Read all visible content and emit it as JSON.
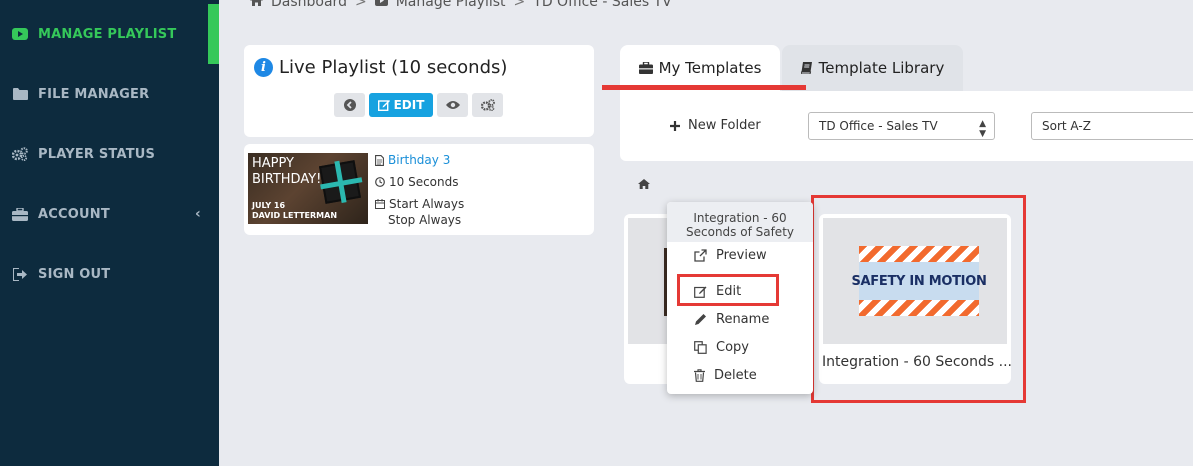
{
  "sidebar": {
    "items": [
      {
        "label": "MANAGE PLAYLIST",
        "icon": "play-icon",
        "active": true
      },
      {
        "label": "FILE MANAGER",
        "icon": "folder-icon",
        "active": false
      },
      {
        "label": "PLAYER STATUS",
        "icon": "gears-icon",
        "active": false
      },
      {
        "label": "ACCOUNT",
        "icon": "briefcase-icon",
        "active": false
      },
      {
        "label": "SIGN OUT",
        "icon": "signout-icon",
        "active": false
      }
    ],
    "account_chevron": "‹",
    "accent_color": "#35c85a",
    "background": "#0d2b3e"
  },
  "breadcrumb": {
    "items": [
      "Dashboard",
      "Manage Playlist",
      "TD Office - Sales TV"
    ],
    "separator": ">"
  },
  "live_playlist": {
    "title": "Live Playlist (10 seconds)",
    "edit_label": "EDIT"
  },
  "playlist_item": {
    "thumb_line1": "HAPPY",
    "thumb_line2": "BIRTHDAY!",
    "thumb_line3": "JULY 16",
    "thumb_line4": "DAVID LETTERMAN",
    "name": "Birthday 3",
    "duration": "10 Seconds",
    "start": "Start Always",
    "stop": "Stop Always"
  },
  "tabs": [
    {
      "label": "My Templates",
      "active": true
    },
    {
      "label": "Template Library",
      "active": false
    }
  ],
  "toolbar": {
    "new_folder_label": "New Folder",
    "location_select": "TD Office - Sales TV",
    "sort_select": "Sort A-Z"
  },
  "context_menu": {
    "title": "Integration - 60 Seconds of Safety",
    "items": [
      "Preview",
      "Edit",
      "Rename",
      "Copy",
      "Delete"
    ]
  },
  "card": {
    "banner_text": "SAFETY IN MOTION",
    "caption": "Integration - 60 Seconds ..."
  },
  "colors": {
    "highlight_red": "#e53935",
    "link_blue": "#1a8fd8",
    "button_blue": "#17a2e0"
  }
}
